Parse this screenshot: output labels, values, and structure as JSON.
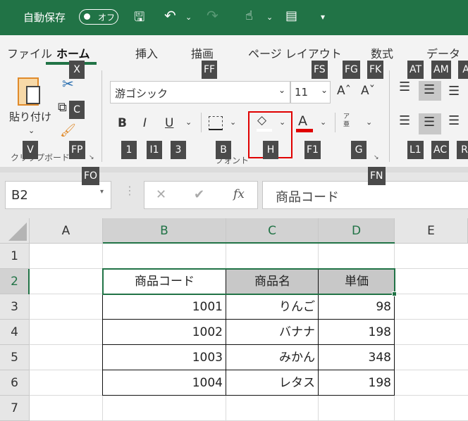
{
  "title_bar": {
    "autosave_label": "自動保存",
    "autosave_state": "オフ",
    "icons": [
      "save-icon",
      "undo-icon",
      "redo-icon",
      "touch-mode-icon",
      "form-icon",
      "customize-qat-icon"
    ]
  },
  "tabs": [
    {
      "label": "ファイル"
    },
    {
      "label": "ホーム",
      "active": true
    },
    {
      "label": "挿入"
    },
    {
      "label": "描画"
    },
    {
      "label": "ページ レイアウト"
    },
    {
      "label": "数式"
    },
    {
      "label": "データ"
    }
  ],
  "ribbon": {
    "clipboard": {
      "paste_label": "貼り付け",
      "group_label": "クリップボード"
    },
    "font": {
      "font_name": "游ゴシック",
      "font_size": "11",
      "bold": "B",
      "italic": "I",
      "underline": "U",
      "font_color_glyph": "A",
      "furigana_top": "ア",
      "furigana_bottom": "亜",
      "group_label": "フォント",
      "font_color": "#e00000"
    }
  },
  "keytips": [
    "X",
    "FF",
    "FS",
    "FG",
    "FK",
    "AT",
    "AM",
    "A",
    "C",
    "V",
    "FP",
    "1",
    "I1",
    "3",
    "B",
    "H",
    "F1",
    "G",
    "L1",
    "AC",
    "R",
    "FO",
    "FN"
  ],
  "formula_bar": {
    "name_box": "B2",
    "cancel": "✕",
    "enter": "✔",
    "fx": "fx",
    "content": "商品コード"
  },
  "sheet": {
    "columns": [
      "A",
      "B",
      "C",
      "D",
      "E"
    ],
    "rows": [
      "1",
      "2",
      "3",
      "4",
      "5",
      "6",
      "7"
    ],
    "selected_cell": "B2",
    "header_row": [
      "商品コード",
      "商品名",
      "単価"
    ],
    "data": [
      [
        "1001",
        "りんご",
        "98"
      ],
      [
        "1002",
        "バナナ",
        "198"
      ],
      [
        "1003",
        "みかん",
        "348"
      ],
      [
        "1004",
        "レタス",
        "198"
      ]
    ]
  },
  "colors": {
    "accent": "#217346",
    "highlight_box": "#e00000",
    "header_fill": "#c8c8c8"
  }
}
